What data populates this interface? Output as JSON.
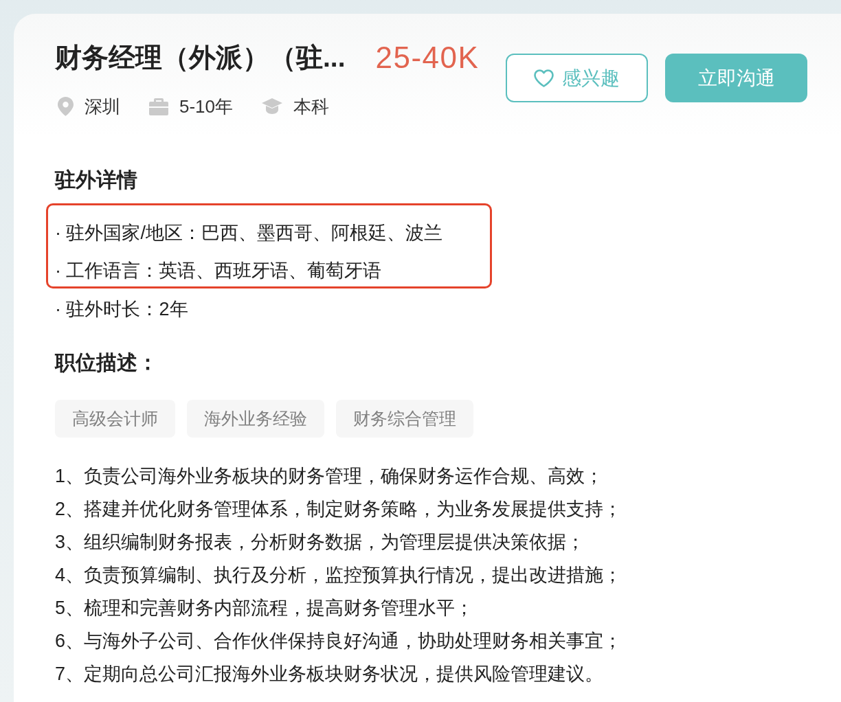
{
  "header": {
    "title": "财务经理（外派）（驻...",
    "salary": "25-40K",
    "meta": [
      {
        "kind": "location",
        "text": "深圳"
      },
      {
        "kind": "experience",
        "text": "5-10年"
      },
      {
        "kind": "education",
        "text": "本科"
      }
    ],
    "buttons": [
      {
        "kind": "outline",
        "label": "感兴趣"
      },
      {
        "kind": "filled",
        "label": "立即沟通"
      }
    ]
  },
  "overseas": {
    "heading": "驻外详情",
    "items": [
      {
        "text": "· 驻外国家/地区：巴西、墨西哥、阿根廷、波兰",
        "highlighted": true
      },
      {
        "text": "· 工作语言：英语、西班牙语、葡萄牙语",
        "highlighted": true
      },
      {
        "text": "· 驻外时长：2年",
        "highlighted": false
      }
    ]
  },
  "description": {
    "heading": "职位描述：",
    "tags": [
      "高级会计师",
      "海外业务经验",
      "财务综合管理"
    ],
    "duties": [
      "1、负责公司海外业务板块的财务管理，确保财务运作合规、高效；",
      "2、搭建并优化财务管理体系，制定财务策略，为业务发展提供支持；",
      "3、组织编制财务报表，分析财务数据，为管理层提供决策依据；",
      "4、负责预算编制、执行及分析，监控预算执行情况，提出改进措施；",
      "5、梳理和完善财务内部流程，提高财务管理水平；",
      "6、与海外子公司、合作伙伴保持良好沟通，协助处理财务相关事宜；",
      "7、定期向总公司汇报海外业务板块财务状况，提供风险管理建议。"
    ]
  }
}
